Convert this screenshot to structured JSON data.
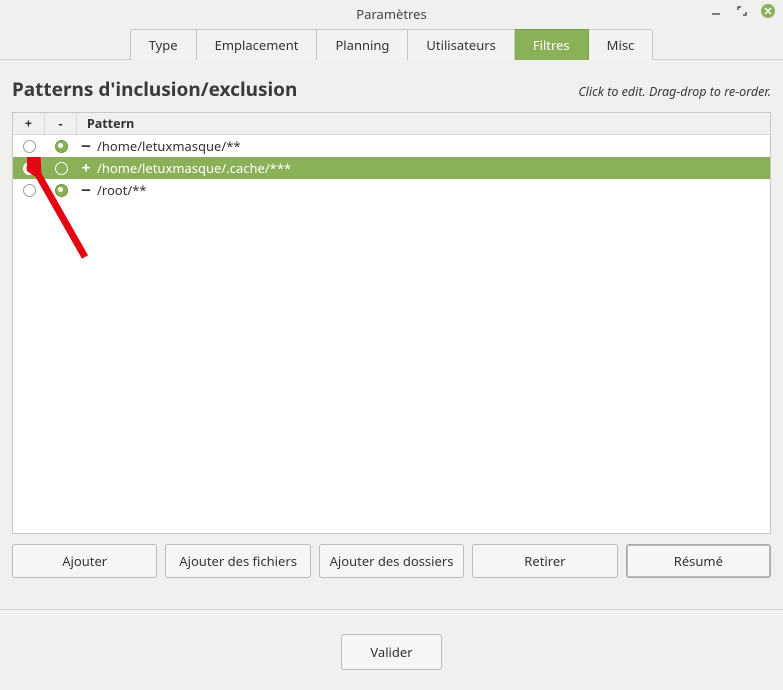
{
  "window": {
    "title": "Paramètres"
  },
  "tabs": [
    "Type",
    "Emplacement",
    "Planning",
    "Utilisateurs",
    "Filtres",
    "Misc"
  ],
  "active_tab_index": 4,
  "page_title": "Patterns d'inclusion/exclusion",
  "hint_text": "Click to edit. Drag-drop to re-order.",
  "columns": {
    "plus": "+",
    "minus": "-",
    "pattern": "Pattern"
  },
  "rows": [
    {
      "include": false,
      "exclude": true,
      "sign": "—",
      "pattern": "/home/letuxmasque/**",
      "selected": false
    },
    {
      "include": true,
      "exclude": false,
      "sign": "+",
      "pattern": "/home/letuxmasque/.cache/***",
      "selected": true
    },
    {
      "include": false,
      "exclude": true,
      "sign": "—",
      "pattern": "/root/**",
      "selected": false
    }
  ],
  "buttons": {
    "add": "Ajouter",
    "add_files": "Ajouter des fichiers",
    "add_folders": "Ajouter des dossiers",
    "remove": "Retirer",
    "summary": "Résumé",
    "validate": "Valider"
  }
}
